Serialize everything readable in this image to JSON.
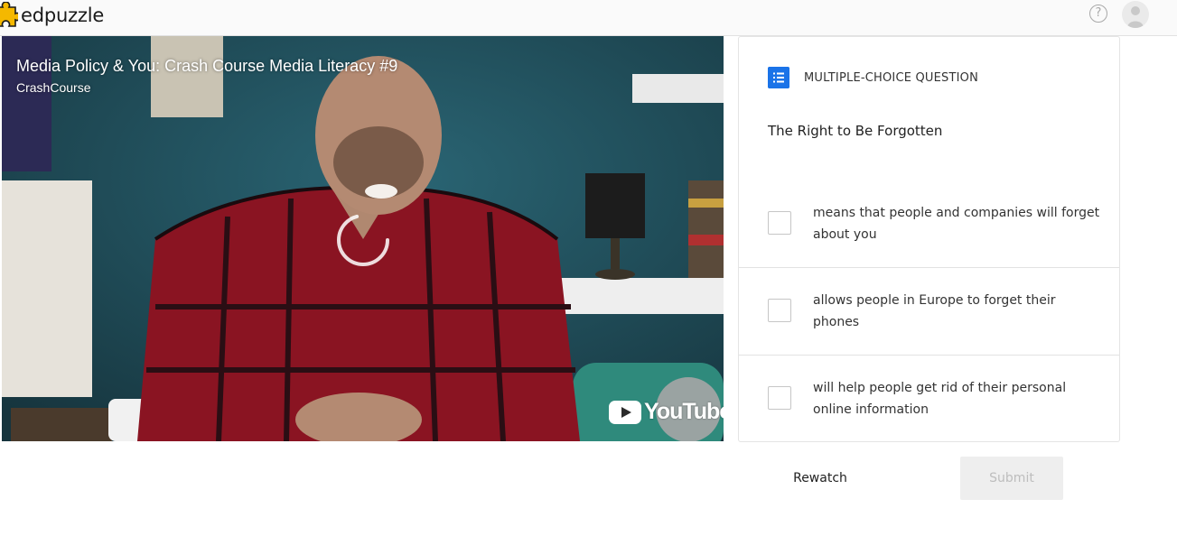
{
  "header": {
    "logo_text": "edpuzzle",
    "help_symbol": "?",
    "colors": {
      "logo_accent": "#f5b800"
    }
  },
  "video": {
    "title": "Media Policy & You: Crash Course Media Literacy #9",
    "channel": "CrashCourse",
    "youtube_label": "YouTube",
    "state": "loading"
  },
  "question": {
    "type_label": "MULTIPLE-CHOICE QUESTION",
    "text": "The Right to Be Forgotten",
    "choices": [
      {
        "label": "means that people and companies will forget about you",
        "checked": false
      },
      {
        "label": "allows people in Europe to forget their phones",
        "checked": false
      },
      {
        "label": "will help people get rid of their personal online information",
        "checked": false
      }
    ],
    "type_icon_color": "#1a73e8"
  },
  "actions": {
    "rewatch_label": "Rewatch",
    "submit_label": "Submit",
    "submit_enabled": false
  }
}
